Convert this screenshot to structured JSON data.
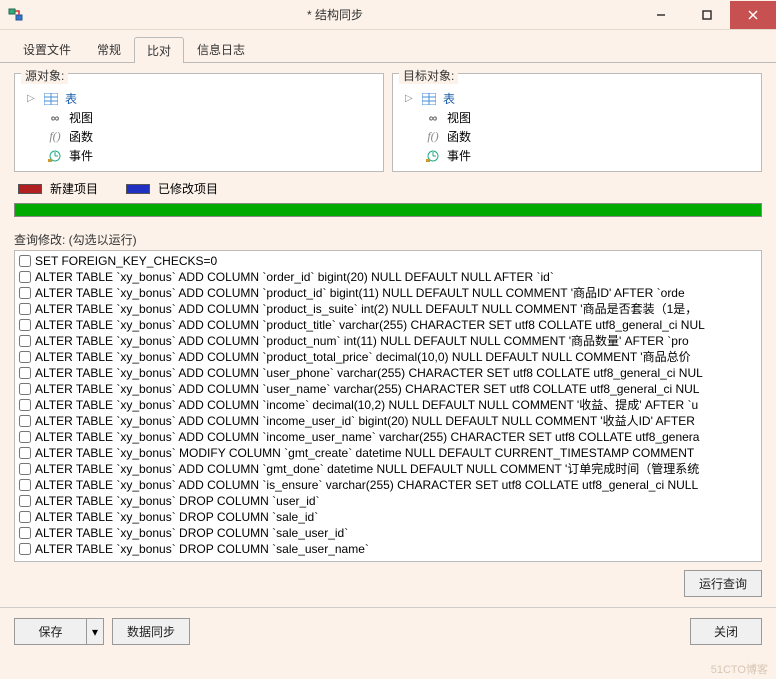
{
  "window": {
    "title": "* 结构同步"
  },
  "tabs": [
    "设置文件",
    "常规",
    "比对",
    "信息日志"
  ],
  "active_tab": 2,
  "source": {
    "label": "源对象:",
    "root": "表",
    "items": [
      "视图",
      "函数",
      "事件"
    ]
  },
  "target": {
    "label": "目标对象:",
    "root": "表",
    "items": [
      "视图",
      "函数",
      "事件"
    ]
  },
  "legend": {
    "new_color": "#b02020",
    "new_label": "新建项目",
    "mod_color": "#2030c0",
    "mod_label": "已修改项目"
  },
  "query": {
    "label": "查询修改: (勾选以运行)",
    "items": [
      "SET FOREIGN_KEY_CHECKS=0",
      "ALTER TABLE `xy_bonus` ADD COLUMN `order_id`  bigint(20) NULL DEFAULT NULL AFTER `id`",
      "ALTER TABLE `xy_bonus` ADD COLUMN `product_id`  bigint(11) NULL DEFAULT NULL COMMENT '商品ID' AFTER `orde",
      "ALTER TABLE `xy_bonus` ADD COLUMN `product_is_suite`  int(2) NULL DEFAULT NULL COMMENT '商品是否套装（1是，",
      "ALTER TABLE `xy_bonus` ADD COLUMN `product_title`  varchar(255) CHARACTER SET utf8 COLLATE utf8_general_ci NUL",
      "ALTER TABLE `xy_bonus` ADD COLUMN `product_num`  int(11) NULL DEFAULT NULL COMMENT '商品数量' AFTER `pro",
      "ALTER TABLE `xy_bonus` ADD COLUMN `product_total_price`  decimal(10,0) NULL DEFAULT NULL COMMENT '商品总价",
      "ALTER TABLE `xy_bonus` ADD COLUMN `user_phone`  varchar(255) CHARACTER SET utf8 COLLATE utf8_general_ci NUL",
      "ALTER TABLE `xy_bonus` ADD COLUMN `user_name`  varchar(255) CHARACTER SET utf8 COLLATE utf8_general_ci NUL",
      "ALTER TABLE `xy_bonus` ADD COLUMN `income`  decimal(10,2) NULL DEFAULT NULL COMMENT '收益、提成' AFTER `u",
      "ALTER TABLE `xy_bonus` ADD COLUMN `income_user_id`  bigint(20) NULL DEFAULT NULL COMMENT '收益人ID' AFTER",
      "ALTER TABLE `xy_bonus` ADD COLUMN `income_user_name`  varchar(255) CHARACTER SET utf8 COLLATE utf8_genera",
      "ALTER TABLE `xy_bonus` MODIFY COLUMN `gmt_create`  datetime NULL DEFAULT CURRENT_TIMESTAMP COMMENT",
      "ALTER TABLE `xy_bonus` ADD COLUMN `gmt_done`  datetime NULL DEFAULT NULL COMMENT '订单完成时间（管理系统",
      "ALTER TABLE `xy_bonus` ADD COLUMN `is_ensure`  varchar(255) CHARACTER SET utf8 COLLATE utf8_general_ci NULL",
      "ALTER TABLE `xy_bonus` DROP COLUMN `user_id`",
      "ALTER TABLE `xy_bonus` DROP COLUMN `sale_id`",
      "ALTER TABLE `xy_bonus` DROP COLUMN `sale_user_id`",
      "ALTER TABLE `xy_bonus` DROP COLUMN `sale_user_name`"
    ]
  },
  "buttons": {
    "run_query": "运行查询",
    "save": "保存",
    "data_sync": "数据同步",
    "close": "关闭"
  },
  "icons": {
    "table": "table-icon",
    "view": "glasses-icon",
    "function": "fx-icon",
    "event": "clock-icon"
  },
  "watermark": "51CTO博客"
}
